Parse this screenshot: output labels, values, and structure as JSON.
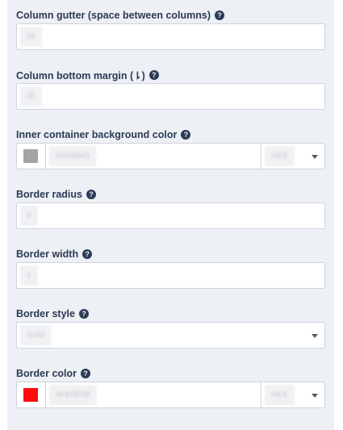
{
  "fields": {
    "column_gutter": {
      "label": "Column gutter (space between columns)",
      "value": "16"
    },
    "column_bottom_margin": {
      "label": "Column bottom margin (⇂)",
      "value": "35"
    },
    "inner_bg_color": {
      "label": "Inner container background color",
      "value": "#A5A5A5",
      "swatch": "#a5a5a5",
      "format": "HEX"
    },
    "border_radius": {
      "label": "Border radius",
      "value": "0"
    },
    "border_width": {
      "label": "Border width",
      "value": "1"
    },
    "border_style": {
      "label": "Border style",
      "value": "Solid"
    },
    "border_color": {
      "label": "Border color",
      "value": "#FE0B0B",
      "swatch": "#fe0b0b",
      "format": "HEX"
    }
  },
  "help_glyph": "?"
}
